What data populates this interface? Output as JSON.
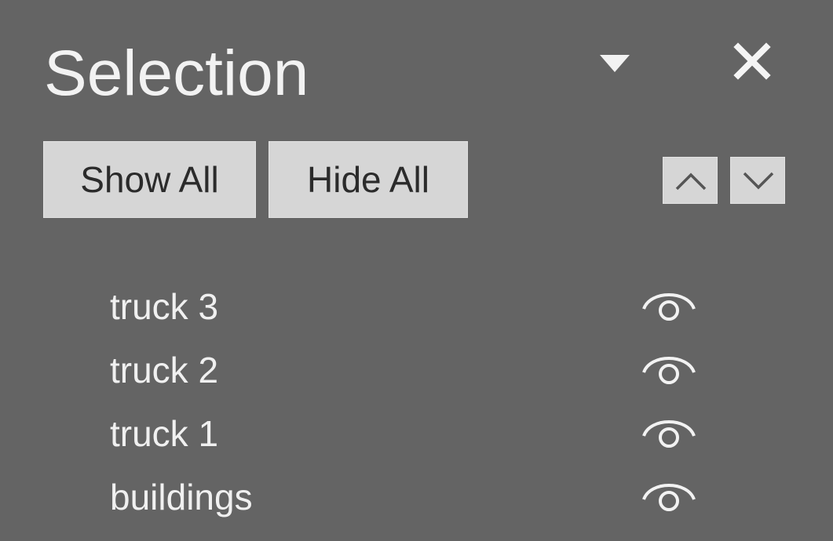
{
  "pane": {
    "title": "Selection",
    "menu_icon": "triangle-down-icon",
    "close_icon": "close-icon"
  },
  "toolbar": {
    "show_all_label": "Show All",
    "hide_all_label": "Hide All",
    "bring_forward_icon": "chevron-up-icon",
    "send_backward_icon": "chevron-down-icon"
  },
  "objects": [
    {
      "label": "truck 3",
      "visibility_icon": "eye-icon",
      "visible": true
    },
    {
      "label": "truck 2",
      "visibility_icon": "eye-icon",
      "visible": true
    },
    {
      "label": "truck 1",
      "visibility_icon": "eye-icon",
      "visible": true
    },
    {
      "label": "buildings",
      "visibility_icon": "eye-icon",
      "visible": true
    }
  ],
  "colors": {
    "pane_background": "#646464",
    "button_background": "#d6d6d6",
    "button_text": "#2b2b2b",
    "text": "#f0f0f0"
  }
}
